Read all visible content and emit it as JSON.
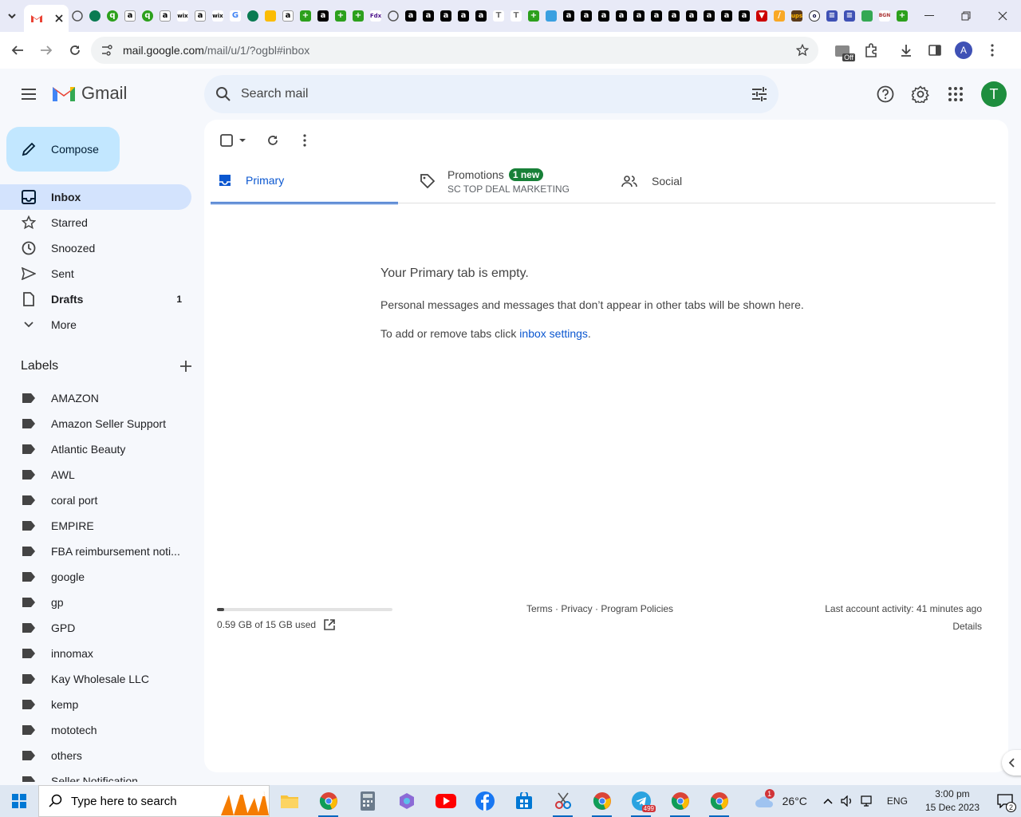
{
  "browser": {
    "url_host": "mail.google.com",
    "url_path": "/mail/u/1/?ogbl#inbox",
    "profile_initial": "A",
    "extension_badge": "Off",
    "tabs_favicons": [
      "amazon",
      "amazon",
      "amazon",
      "amazon",
      "amazon",
      "amazon",
      "amazon",
      "amazon",
      "amazon",
      "amazon",
      "amazon",
      "amazon",
      "amazon",
      "amazon",
      "amazon",
      "amazon",
      "amazon"
    ]
  },
  "gmail": {
    "logo_text": "Gmail",
    "search_placeholder": "Search mail",
    "avatar_initial": "T",
    "compose_label": "Compose",
    "nav": [
      {
        "label": "Inbox",
        "count": ""
      },
      {
        "label": "Starred",
        "count": ""
      },
      {
        "label": "Snoozed",
        "count": ""
      },
      {
        "label": "Sent",
        "count": ""
      },
      {
        "label": "Drafts",
        "count": "1"
      },
      {
        "label": "More",
        "count": ""
      }
    ],
    "labels_heading": "Labels",
    "labels": [
      "AMAZON",
      "Amazon Seller Support",
      "Atlantic Beauty",
      "AWL",
      "coral port",
      "EMPIRE",
      "FBA reimbursement noti...",
      "google",
      "gp",
      "GPD",
      "innomax",
      "Kay Wholesale LLC",
      "kemp",
      "mototech",
      "others",
      "Seller Notification"
    ],
    "category_tabs": {
      "primary": "Primary",
      "promotions": "Promotions",
      "promotions_badge": "1 new",
      "promotions_sub": "SC TOP DEAL MARKETING",
      "social": "Social"
    },
    "empty": {
      "title": "Your Primary tab is empty.",
      "line1": "Personal messages and messages that don’t appear in other tabs will be shown here.",
      "line2_prefix": "To add or remove tabs click ",
      "line2_link": "inbox settings",
      "line2_suffix": "."
    },
    "footer": {
      "storage": "0.59 GB of 15 GB used",
      "storage_fraction": 0.039,
      "terms": "Terms",
      "sep": " · ",
      "privacy": "Privacy",
      "policies": "Program Policies",
      "activity": "Last account activity: 41 minutes ago",
      "details": "Details"
    }
  },
  "taskbar": {
    "search_placeholder": "Type here to search",
    "weather_badge": "1",
    "temperature": "26°C",
    "language": "ENG",
    "time": "3:00 pm",
    "date": "15 Dec 2023",
    "notification_count": "2",
    "telegram_badge": "499"
  }
}
